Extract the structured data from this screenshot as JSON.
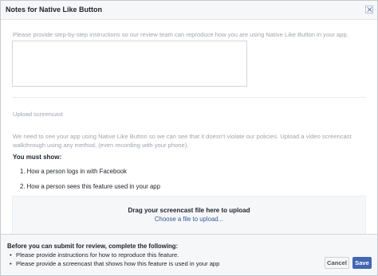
{
  "header": {
    "title": "Notes for Native Like Button"
  },
  "instructions": {
    "label": "Please provide step-by-step instructions so our review team can reproduce how you are using Native Like Button in your app.",
    "value": ""
  },
  "screencast": {
    "label": "Upload screencast",
    "description": "We need to see your app using Native Like Button so we can see that it doesn't violate our policies. Upload a video screencast walkthrough using any method, (even recording with your phone).",
    "must_show_title": "You must show:",
    "steps": [
      "1. How a person logs in with Facebook",
      "2. How a person sees this feature used in your app"
    ],
    "dropzone": {
      "title": "Drag your screencast file here to upload",
      "link": "Choose a file to upload..."
    }
  },
  "footer": {
    "title": "Before you can submit for review, complete the following:",
    "requirements": [
      "Please provide instructions for how to reproduce this feature.",
      "Please provide a screencast that shows how this feature is used in your app"
    ],
    "cancel_label": "Cancel",
    "save_label": "Save"
  },
  "colors": {
    "primary": "#4267b2",
    "link": "#365899",
    "muted_text": "#a0a5ad",
    "panel_bg": "#f6f7f9"
  }
}
